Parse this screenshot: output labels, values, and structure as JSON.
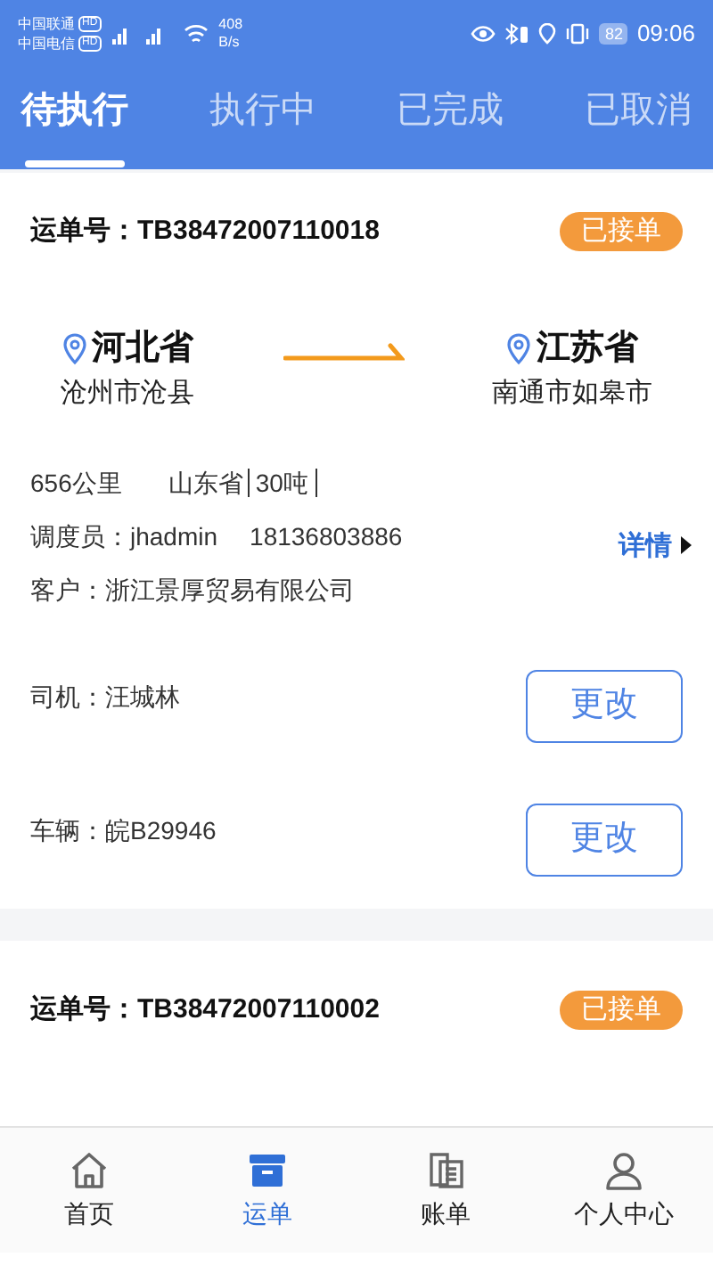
{
  "status_bar": {
    "carrier_1": "中国联通",
    "carrier_2": "中国电信",
    "hd_1": "HD",
    "hd_2": "HD",
    "speed": "408",
    "speed_unit": "B/s",
    "battery": "82",
    "time": "09:06"
  },
  "tabs": [
    {
      "label": "待执行",
      "selected": true
    },
    {
      "label": "执行中",
      "selected": false
    },
    {
      "label": "已完成",
      "selected": false
    },
    {
      "label": "已取消",
      "selected": false
    }
  ],
  "orders": [
    {
      "order_label": "运单号：",
      "order_no": "TB38472007110018",
      "status": "已接单",
      "from_province": "河北省",
      "from_city": "沧州市沧县",
      "to_province": "江苏省",
      "to_city": "南通市如皋市",
      "distance": "656公里",
      "via": "山东省",
      "weight": "30吨",
      "dispatcher": "调度员：jhadmin",
      "phone": "18136803886",
      "details": "详情",
      "customer": "客户：浙江景厚贸易有限公司",
      "driver": "司机：汪城林",
      "vehicle": "车辆：皖B29946",
      "change_buttons": [
        "更改",
        "更改"
      ]
    },
    {
      "order_label": "运单号：",
      "order_no": "TB38472007110002",
      "status": "已接单"
    }
  ],
  "nav": [
    {
      "label": "首页",
      "kind": "home",
      "selected": false
    },
    {
      "label": "运单",
      "kind": "box",
      "selected": true
    },
    {
      "label": "账单",
      "kind": "bill",
      "selected": false
    },
    {
      "label": "个人中心",
      "kind": "user",
      "selected": false
    }
  ]
}
